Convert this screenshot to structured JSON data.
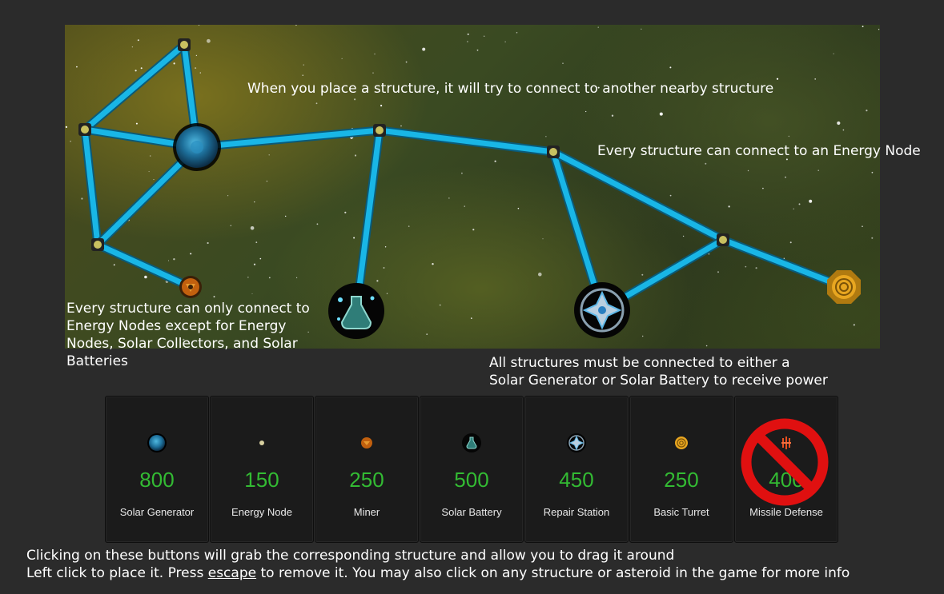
{
  "tips": {
    "connect": "When you place a structure, it will try to connect to another nearby structure",
    "energy_node": "Every structure can connect to an Energy Node",
    "only_connect": "Every structure can only connect to Energy Nodes except for Energy Nodes, Solar Collectors, and Solar Batteries",
    "power_line1": "All structures must be connected to either a",
    "power_line2": "Solar Generator or Solar Battery to receive power"
  },
  "structures": [
    {
      "name": "Solar Generator",
      "cost": "800",
      "icon": "solar-generator-icon",
      "available": true
    },
    {
      "name": "Energy Node",
      "cost": "150",
      "icon": "energy-node-icon",
      "available": true
    },
    {
      "name": "Miner",
      "cost": "250",
      "icon": "miner-icon",
      "available": true
    },
    {
      "name": "Solar Battery",
      "cost": "500",
      "icon": "solar-battery-icon",
      "available": true
    },
    {
      "name": "Repair Station",
      "cost": "450",
      "icon": "repair-station-icon",
      "available": true
    },
    {
      "name": "Basic Turret",
      "cost": "250",
      "icon": "basic-turret-icon",
      "available": true
    },
    {
      "name": "Missile Defense",
      "cost": "400",
      "icon": "missile-defense-icon",
      "available": false
    }
  ],
  "instructions": {
    "line1": "Clicking on these buttons will grab the corresponding structure and allow you to drag it around",
    "line2_part1": "Left click to place it.  Press ",
    "line2_key": "escape",
    "line2_part2": " to remove it.  You may also click on any structure or asteroid in the game for more info"
  },
  "colors": {
    "cost": "#33bb33",
    "beam": "#19b6e6",
    "unavailable": "#e01010",
    "panel": "#1b1b1b",
    "background": "#2b2b2b"
  }
}
